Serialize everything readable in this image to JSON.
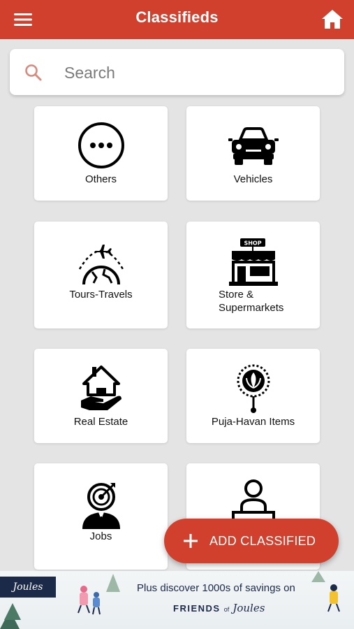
{
  "header": {
    "title": "Classifieds",
    "menu_icon": "hamburger-menu-icon",
    "home_icon": "home-icon"
  },
  "search": {
    "placeholder": "Search",
    "icon": "search-icon"
  },
  "categories": [
    {
      "label": "Others",
      "icon": "more-dots-icon"
    },
    {
      "label": "Vehicles",
      "icon": "car-icon"
    },
    {
      "label": "Tours-Travels",
      "icon": "airplane-globe-icon"
    },
    {
      "label": "Store &\nSupermarkets",
      "icon": "shop-icon"
    },
    {
      "label": "Real Estate",
      "icon": "house-hand-icon"
    },
    {
      "label": "Puja-Havan Items",
      "icon": "puja-icon"
    },
    {
      "label": "Jobs",
      "icon": "target-person-icon"
    },
    {
      "label": "",
      "icon": "network-person-icon"
    }
  ],
  "fab": {
    "label": "ADD CLASSIFIED",
    "icon": "plus-icon"
  },
  "ad": {
    "logo": "Joules",
    "line1": "Plus discover 1000s of savings on",
    "line2_prefix": "FRIENDS",
    "line2_of": "of",
    "line2_brand": "Joules"
  },
  "colors": {
    "primary": "#d1402d",
    "background": "#e4e4e4",
    "card": "#ffffff",
    "ad_navy": "#1c2a4a"
  }
}
